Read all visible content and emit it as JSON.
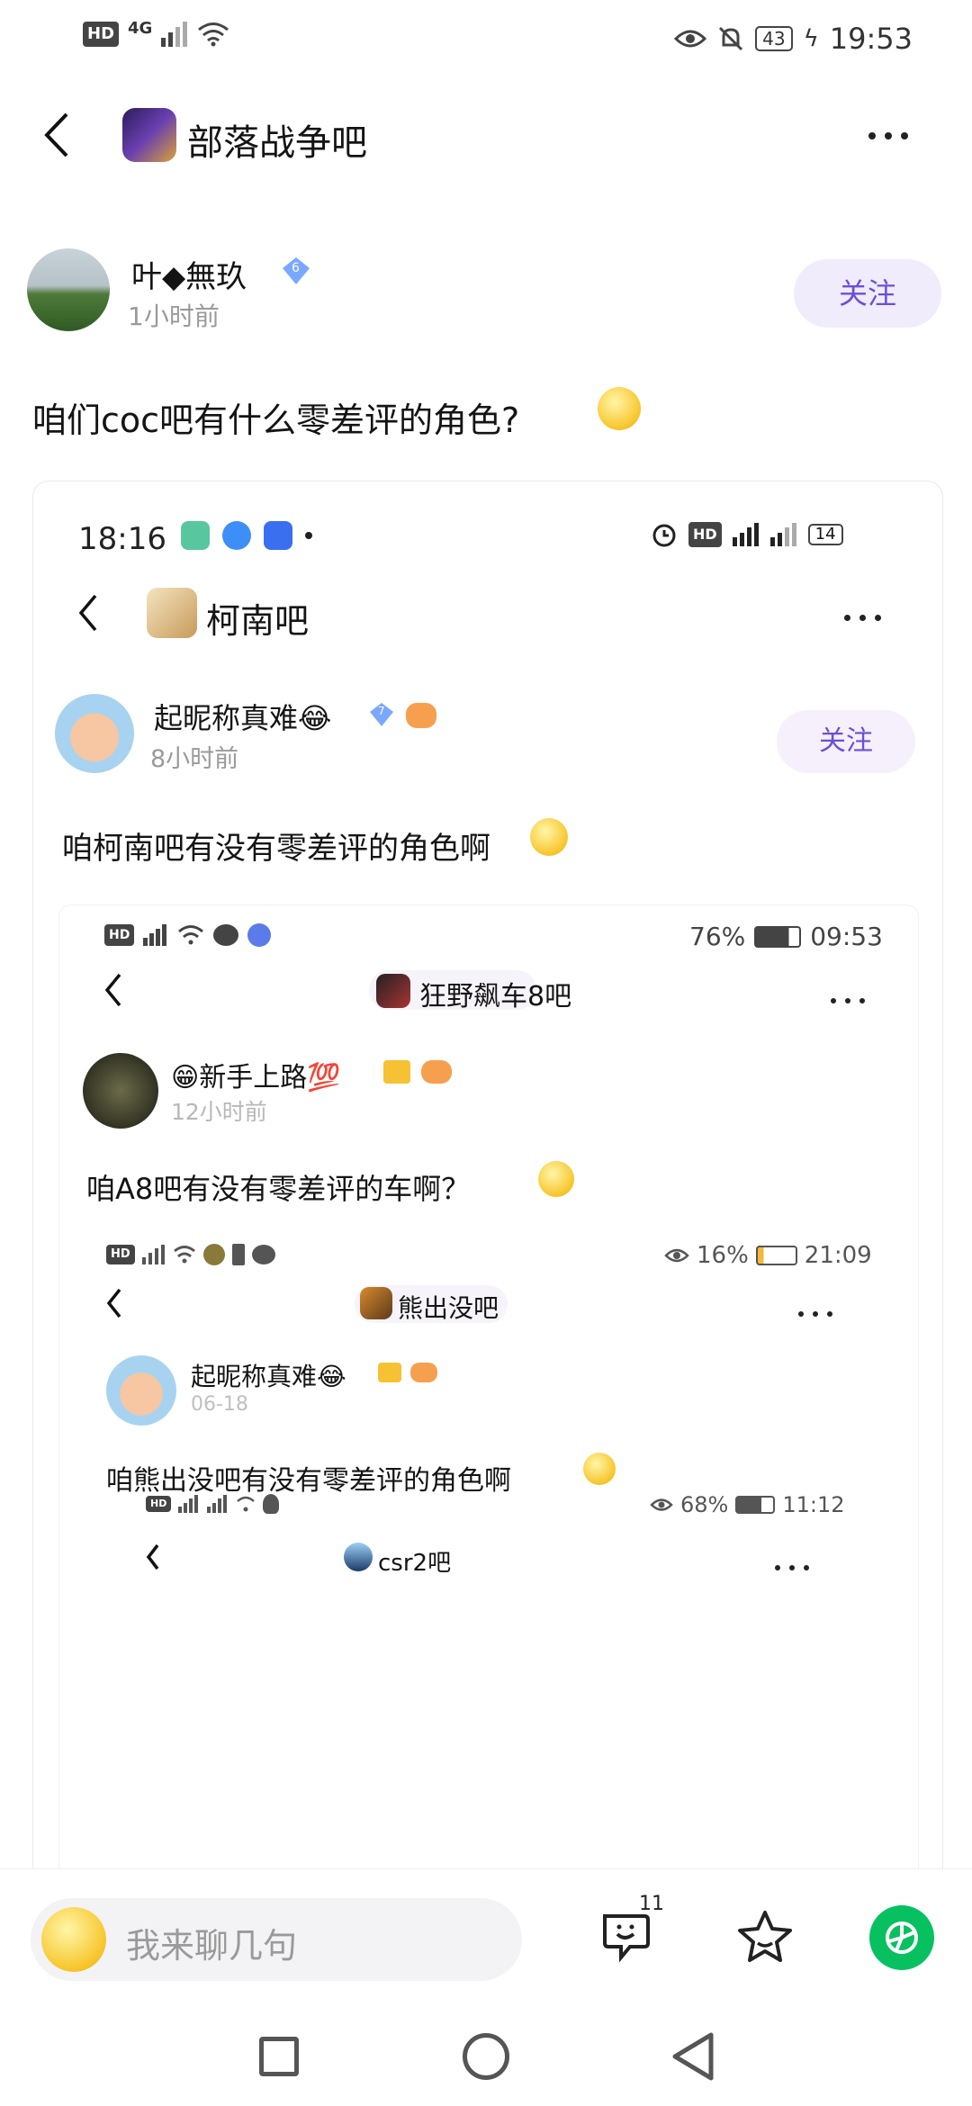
{
  "status_bar": {
    "hd": "HD",
    "net": "4G",
    "battery": "43",
    "time": "19:53"
  },
  "header": {
    "forum_name": "部落战争吧"
  },
  "post": {
    "author": "叶◆無玖",
    "level": "6",
    "time": "1小时前",
    "follow_label": "关注",
    "text": "咱们coc吧有什么零差评的角色?"
  },
  "nested1": {
    "status_time": "18:16",
    "battery": "14",
    "forum_name": "柯南吧",
    "author": "起昵称真难😂",
    "level": "7",
    "time": "8小时前",
    "follow_label": "关注",
    "text": "咱柯南吧有没有零差评的角色啊"
  },
  "nested2": {
    "status_right": "76%",
    "status_time": "09:53",
    "forum_name": "狂野飙车8吧",
    "author": "😁新手上路💯",
    "time": "12小时前",
    "text": "咱A8吧有没有零差评的车啊？"
  },
  "nested3": {
    "status_right": "16%",
    "status_time": "21:09",
    "forum_name": "熊出没吧",
    "author": "起昵称真难😂",
    "time": "06-18",
    "text": "咱熊出没吧有没有零差评的角色啊"
  },
  "nested4": {
    "status_right": "68%",
    "status_time": "11:12",
    "forum_name": "csr2吧"
  },
  "bottom": {
    "input_placeholder": "我来聊几句",
    "comment_count": "11"
  },
  "colors": {
    "accent": "#6b4fd9",
    "follow_bg": "#f0ecfc",
    "share_green": "#07c160"
  }
}
